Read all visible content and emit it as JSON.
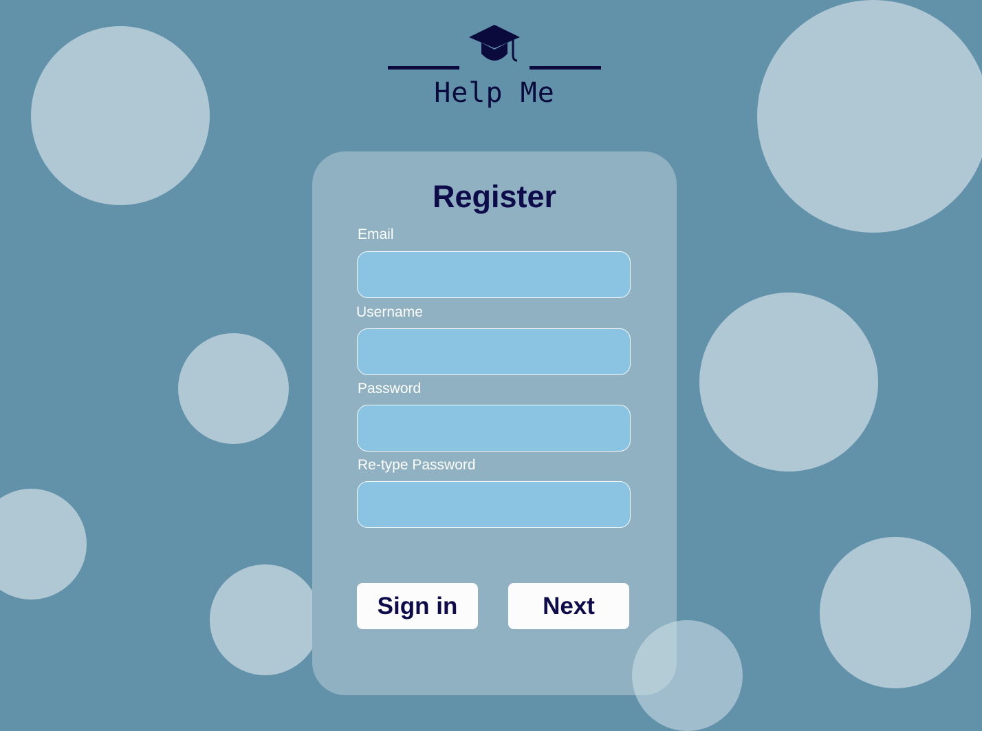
{
  "brand": {
    "name": "Help Me",
    "icon": "graduation-cap-icon"
  },
  "register": {
    "title": "Register",
    "fields": [
      {
        "label": "Email",
        "value": "",
        "placeholder": ""
      },
      {
        "label": "Username",
        "value": "",
        "placeholder": ""
      },
      {
        "label": "Password",
        "value": "",
        "placeholder": ""
      },
      {
        "label": "Re-type Password",
        "value": "",
        "placeholder": ""
      }
    ],
    "buttons": {
      "sign_in": "Sign in",
      "next": "Next"
    }
  },
  "colors": {
    "background": "#6291aa",
    "bubble": "#b0c8d4",
    "card": "#8fb1c2",
    "input_fill": "#8ac4e2",
    "title_text": "#0d0b4a",
    "logo": "#0a0b3c",
    "button_bg": "#fdfcfd"
  }
}
